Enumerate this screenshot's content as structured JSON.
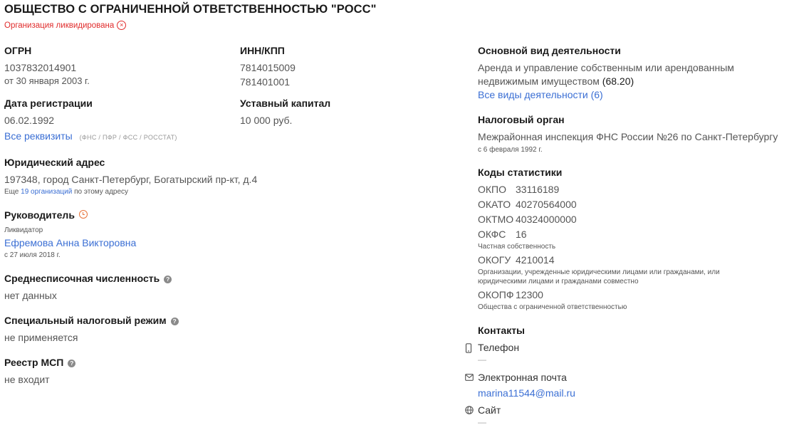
{
  "company": {
    "title": "ОБЩЕСТВО С ОГРАНИЧЕННОЙ ОТВЕТСТВЕННОСТЬЮ \"РОСС\"",
    "status": "Организация ликвидирована"
  },
  "ogrn": {
    "label": "ОГРН",
    "value": "1037832014901",
    "date": "от 30 января 2003 г."
  },
  "inn_kpp": {
    "label": "ИНН/КПП",
    "inn": "7814015009",
    "kpp": "781401001"
  },
  "registration": {
    "label": "Дата регистрации",
    "value": "06.02.1992"
  },
  "capital": {
    "label": "Уставный капитал",
    "value": "10 000 руб."
  },
  "requisites": {
    "link": "Все реквизиты",
    "sources": "(ФНС / ПФР / ФСС / РОССТАТ)"
  },
  "address": {
    "label": "Юридический адрес",
    "value": "197348, город Санкт-Петербург, Богатырский пр-кт, д.4",
    "note_prefix": "Еще",
    "note_link": "19 организаций",
    "note_suffix": "по этому адресу"
  },
  "director": {
    "label": "Руководитель",
    "role": "Ликвидатор",
    "name": "Ефремова Анна Викторовна",
    "since": "с 27 июля 2018 г."
  },
  "headcount": {
    "label": "Среднесписочная численность",
    "value": "нет данных"
  },
  "tax_regime": {
    "label": "Специальный налоговый режим",
    "value": "не применяется"
  },
  "msp": {
    "label": "Реестр МСП",
    "value": "не входит"
  },
  "activity": {
    "label": "Основной вид деятельности",
    "line1": "Аренда и управление собственным или арендованным",
    "line2": "недвижимым имуществом",
    "code": "(68.20)",
    "all_link": "Все виды деятельности (6)"
  },
  "tax_authority": {
    "label": "Налоговый орган",
    "value": "Межрайонная инспекция ФНС России №26 по Санкт-Петербургу",
    "since": "с 6 февраля 1992 г."
  },
  "stats": {
    "label": "Коды статистики",
    "okpo": {
      "code": "ОКПО",
      "value": "33116189"
    },
    "okato": {
      "code": "ОКАТО",
      "value": "40270564000"
    },
    "oktmo": {
      "code": "ОКТМО",
      "value": "40324000000"
    },
    "okfs": {
      "code": "ОКФС",
      "value": "16",
      "desc": "Частная собственность"
    },
    "okogu": {
      "code": "ОКОГУ",
      "value": "4210014",
      "desc1": "Организации, учрежденные юридическими лицами или гражданами, или",
      "desc2": "юридическими лицами и гражданами совместно"
    },
    "okopf": {
      "code": "ОКОПФ",
      "value": "12300",
      "desc": "Общества с ограниченной ответственностью"
    }
  },
  "contacts": {
    "label": "Контакты",
    "phone_label": "Телефон",
    "phone_value": "—",
    "email_label": "Электронная почта",
    "email_value": "marina11544@mail.ru",
    "site_label": "Сайт",
    "site_value": "—"
  },
  "icons": {
    "status": "close-circle-icon",
    "director": "clock-icon",
    "help": "question-icon",
    "phone": "phone-icon",
    "email": "mail-icon",
    "site": "globe-icon"
  },
  "colors": {
    "link": "#3b6fd4",
    "liquidated": "#e02b2b",
    "warning": "#e8743b"
  }
}
